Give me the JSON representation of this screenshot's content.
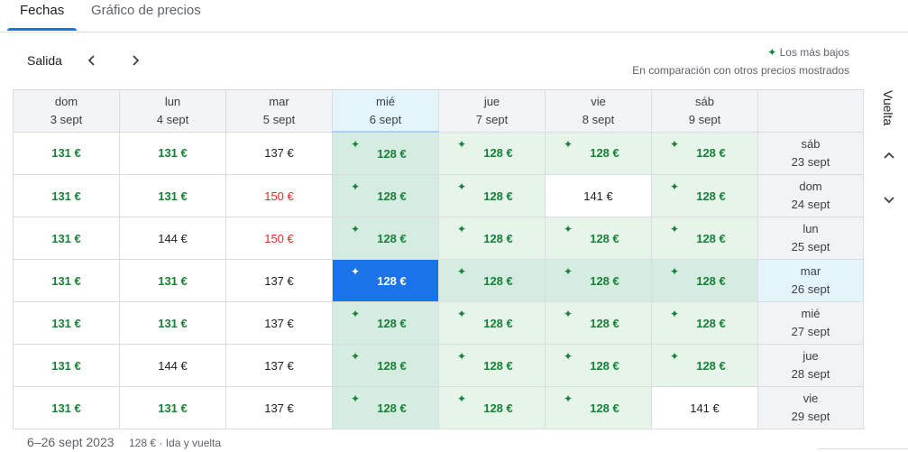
{
  "tabs": [
    {
      "label": "Fechas",
      "active": true
    },
    {
      "label": "Gráfico de precios",
      "active": false
    }
  ],
  "nav": {
    "salida_label": "Salida"
  },
  "legend": {
    "icon": "sparkle-icon",
    "lowest": "Los más bajos",
    "comparison": "En comparación con otros precios mostrados"
  },
  "vuelta_label": "Vuelta",
  "columns": [
    {
      "dow": "dom",
      "date": "3 sept"
    },
    {
      "dow": "lun",
      "date": "4 sept"
    },
    {
      "dow": "mar",
      "date": "5 sept"
    },
    {
      "dow": "mié",
      "date": "6 sept"
    },
    {
      "dow": "jue",
      "date": "7 sept"
    },
    {
      "dow": "vie",
      "date": "8 sept"
    },
    {
      "dow": "sáb",
      "date": "9 sept"
    }
  ],
  "rows": [
    {
      "dow": "sáb",
      "date": "23 sept",
      "cells": [
        {
          "price": "131 €",
          "kind": "low"
        },
        {
          "price": "131 €",
          "kind": "low"
        },
        {
          "price": "137 €",
          "kind": "neutral"
        },
        {
          "price": "128 €",
          "kind": "lowest"
        },
        {
          "price": "128 €",
          "kind": "lowest"
        },
        {
          "price": "128 €",
          "kind": "lowest"
        },
        {
          "price": "128 €",
          "kind": "lowest"
        }
      ]
    },
    {
      "dow": "dom",
      "date": "24 sept",
      "cells": [
        {
          "price": "131 €",
          "kind": "low"
        },
        {
          "price": "131 €",
          "kind": "low"
        },
        {
          "price": "150 €",
          "kind": "high"
        },
        {
          "price": "128 €",
          "kind": "lowest"
        },
        {
          "price": "128 €",
          "kind": "lowest"
        },
        {
          "price": "141 €",
          "kind": "neutral-white"
        },
        {
          "price": "128 €",
          "kind": "lowest"
        }
      ]
    },
    {
      "dow": "lun",
      "date": "25 sept",
      "cells": [
        {
          "price": "131 €",
          "kind": "low"
        },
        {
          "price": "144 €",
          "kind": "neutral"
        },
        {
          "price": "150 €",
          "kind": "high"
        },
        {
          "price": "128 €",
          "kind": "lowest"
        },
        {
          "price": "128 €",
          "kind": "lowest"
        },
        {
          "price": "128 €",
          "kind": "lowest"
        },
        {
          "price": "128 €",
          "kind": "lowest"
        }
      ]
    },
    {
      "dow": "mar",
      "date": "26 sept",
      "selected": true,
      "cells": [
        {
          "price": "131 €",
          "kind": "low"
        },
        {
          "price": "131 €",
          "kind": "low"
        },
        {
          "price": "137 €",
          "kind": "neutral"
        },
        {
          "price": "128 €",
          "kind": "selected"
        },
        {
          "price": "128 €",
          "kind": "lowest"
        },
        {
          "price": "128 €",
          "kind": "lowest"
        },
        {
          "price": "128 €",
          "kind": "lowest"
        }
      ]
    },
    {
      "dow": "mié",
      "date": "27 sept",
      "cells": [
        {
          "price": "131 €",
          "kind": "low"
        },
        {
          "price": "131 €",
          "kind": "low"
        },
        {
          "price": "137 €",
          "kind": "neutral"
        },
        {
          "price": "128 €",
          "kind": "lowest"
        },
        {
          "price": "128 €",
          "kind": "lowest"
        },
        {
          "price": "128 €",
          "kind": "lowest"
        },
        {
          "price": "128 €",
          "kind": "lowest"
        }
      ]
    },
    {
      "dow": "jue",
      "date": "28 sept",
      "cells": [
        {
          "price": "131 €",
          "kind": "low"
        },
        {
          "price": "144 €",
          "kind": "neutral"
        },
        {
          "price": "137 €",
          "kind": "neutral"
        },
        {
          "price": "128 €",
          "kind": "lowest"
        },
        {
          "price": "128 €",
          "kind": "lowest"
        },
        {
          "price": "128 €",
          "kind": "lowest"
        },
        {
          "price": "128 €",
          "kind": "lowest"
        }
      ]
    },
    {
      "dow": "vie",
      "date": "29 sept",
      "cells": [
        {
          "price": "131 €",
          "kind": "low"
        },
        {
          "price": "131 €",
          "kind": "low"
        },
        {
          "price": "137 €",
          "kind": "neutral"
        },
        {
          "price": "128 €",
          "kind": "lowest"
        },
        {
          "price": "128 €",
          "kind": "lowest"
        },
        {
          "price": "128 €",
          "kind": "lowest"
        },
        {
          "price": "141 €",
          "kind": "neutral-white"
        }
      ]
    }
  ],
  "selected": {
    "col": 3,
    "row": 3
  },
  "footer": {
    "dates": "6–26 sept 2023",
    "summary": "128 € · Ida y vuelta"
  },
  "colors": {
    "green": "#188038",
    "red": "#d93025",
    "blue": "#1a73e8",
    "light_green": "#e6f4ea",
    "light_blue": "#e3f5fb"
  }
}
